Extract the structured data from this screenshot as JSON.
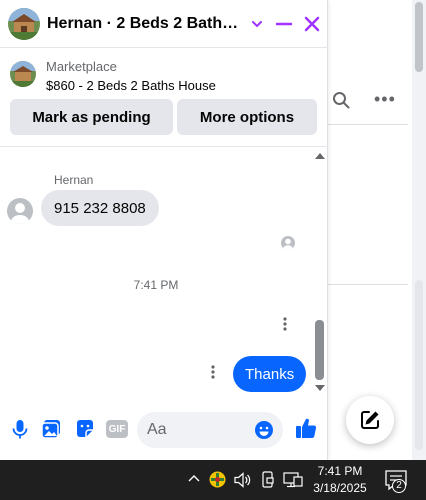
{
  "chat": {
    "title": "Hernan · 2 Beds 2 Baths H...",
    "accent_color": "#a033ff"
  },
  "marketplace": {
    "label": "Marketplace",
    "listing": "$860 - 2 Beds 2 Baths House",
    "primary_action": "Mark as pending",
    "secondary_action": "More options"
  },
  "messages": {
    "sender_name": "Hernan",
    "incoming_text": "915 232 8808",
    "timestamp": "7:41 PM",
    "outgoing_text": "Thanks",
    "outgoing_color": "#0866ff"
  },
  "composer": {
    "placeholder": "Aa",
    "gif_label": "GIF"
  },
  "taskbar": {
    "time": "7:41 PM",
    "date": "3/18/2025",
    "notification_count": "2"
  }
}
